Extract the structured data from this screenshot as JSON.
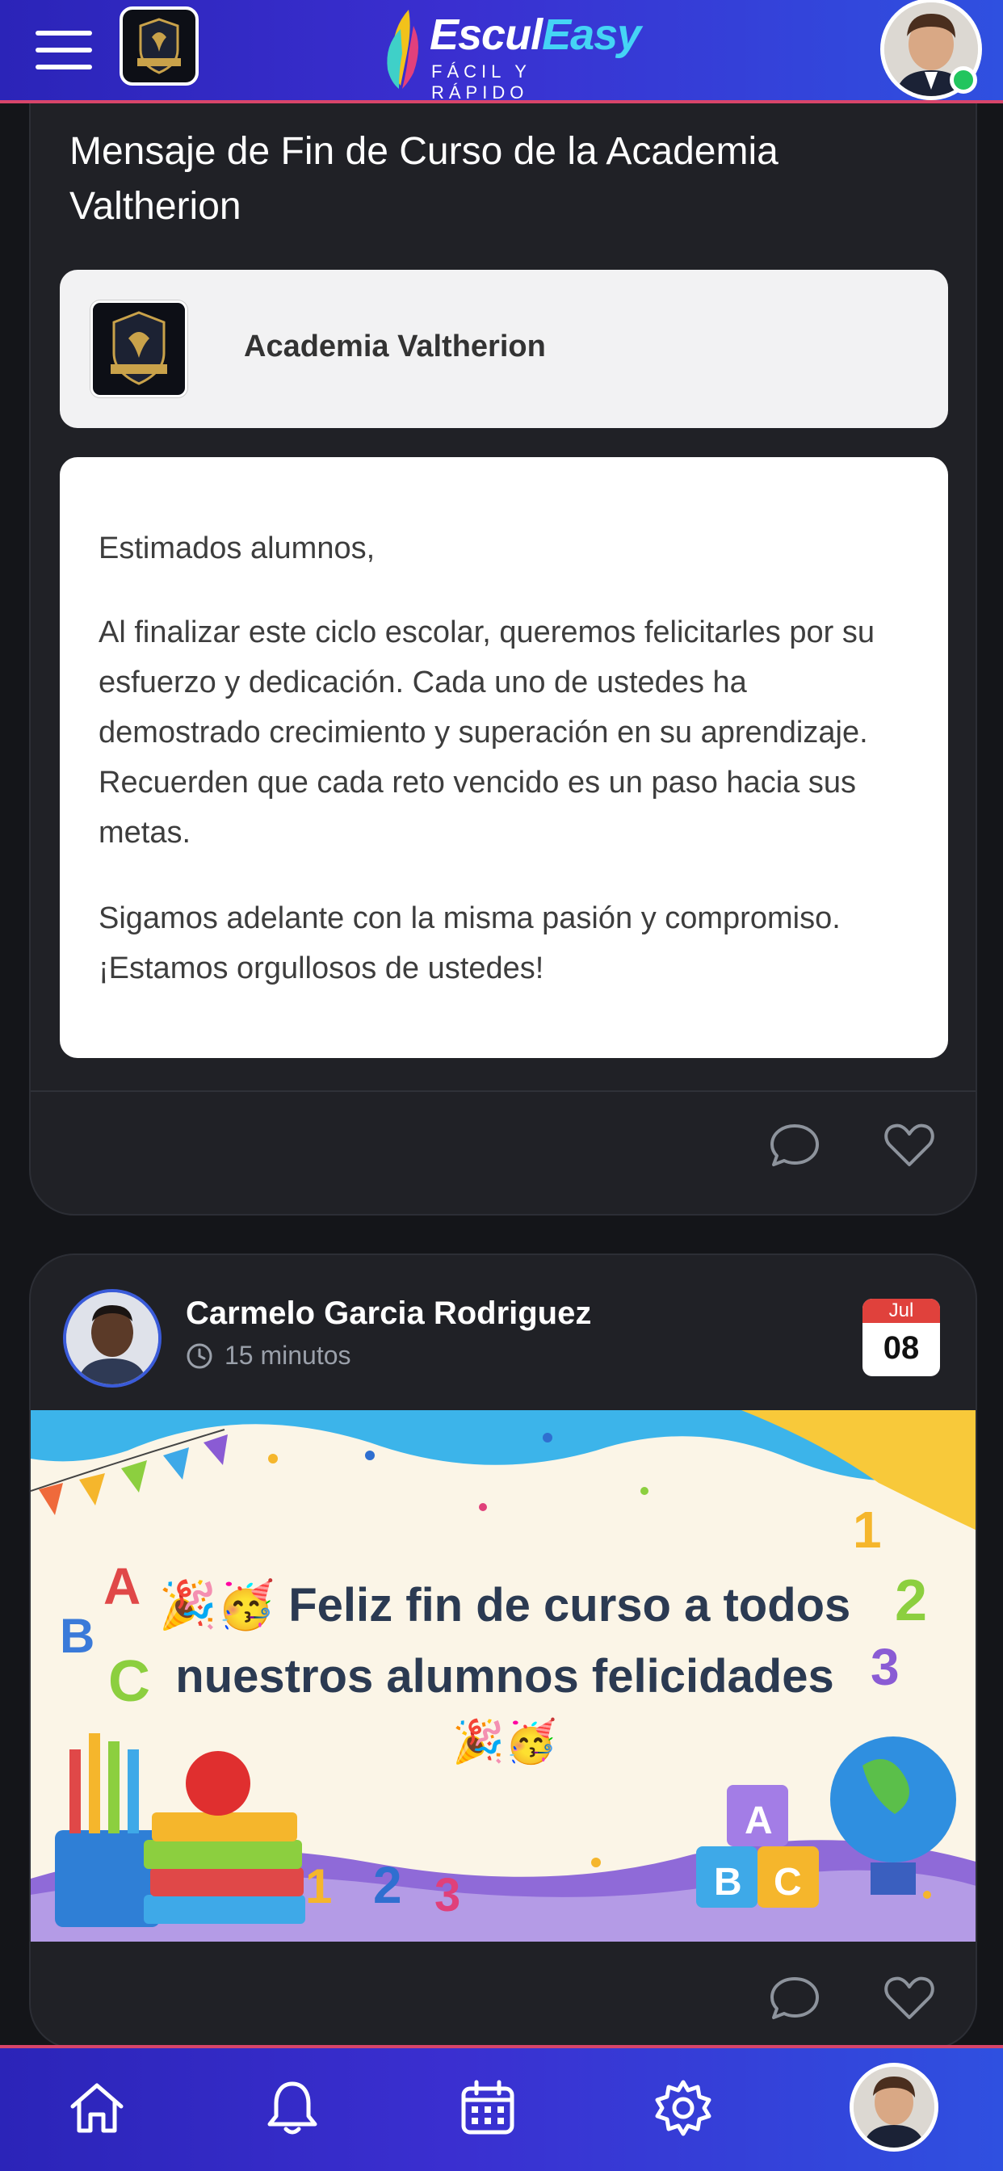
{
  "header": {
    "brand_escul": "Escul",
    "brand_easy": "Easy",
    "brand_tagline": "FÁCIL Y RÁPIDO"
  },
  "posts": [
    {
      "title": "Mensaje de Fin de Curso de la Academia Valtherion",
      "author": "Academia Valtherion",
      "paragraphs": [
        "Estimados alumnos,",
        "Al finalizar este ciclo escolar, queremos felicitarles por su esfuerzo y dedicación. Cada uno de ustedes ha demostrado crecimiento y superación en su aprendizaje. Recuerden que cada reto vencido es un paso hacia sus metas.",
        "Sigamos adelante con la misma pasión y compromiso. ¡Estamos orgullosos de ustedes!"
      ]
    },
    {
      "author": "Carmelo Garcia Rodriguez",
      "time": "15 minutos",
      "date_month": "Jul",
      "date_day": "08",
      "image_line1": "🎉🥳 Feliz fin de curso a todos",
      "image_line2": "nuestros alumnos felicidades",
      "image_line3": "🎉🥳"
    }
  ],
  "colors": {
    "header_start": "#2b24b8",
    "header_end": "#2f50e0",
    "accent_line": "#d8456a",
    "online": "#22c55e",
    "card_bg": "#202126"
  },
  "icons": [
    "menu-icon",
    "comment-icon",
    "heart-icon",
    "clock-icon",
    "home-icon",
    "bell-icon",
    "calendar-icon",
    "settings-icon"
  ]
}
